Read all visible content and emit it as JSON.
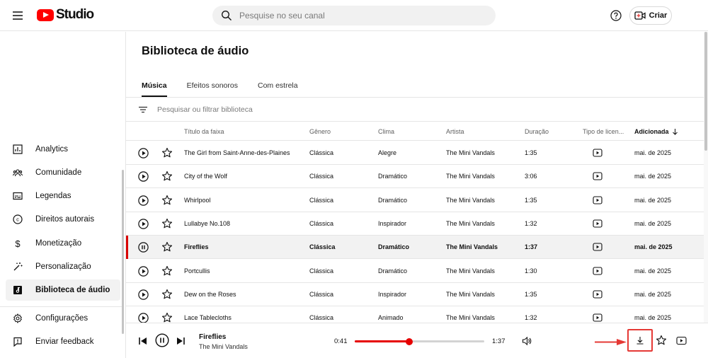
{
  "app": {
    "brand": "Studio",
    "accent": "#ff0000"
  },
  "header": {
    "search_placeholder": "Pesquise no seu canal",
    "create_label": "Criar"
  },
  "sidebar": {
    "items": [
      {
        "label": "Analytics",
        "icon": "analytics-icon"
      },
      {
        "label": "Comunidade",
        "icon": "community-icon"
      },
      {
        "label": "Legendas",
        "icon": "subtitles-icon"
      },
      {
        "label": "Direitos autorais",
        "icon": "copyright-icon"
      },
      {
        "label": "Monetização",
        "icon": "dollar-icon"
      },
      {
        "label": "Personalização",
        "icon": "magic-wand-icon"
      },
      {
        "label": "Biblioteca de áudio",
        "icon": "audio-library-icon",
        "active": true
      }
    ],
    "bottom_items": [
      {
        "label": "Configurações",
        "icon": "gear-icon"
      },
      {
        "label": "Enviar feedback",
        "icon": "feedback-icon"
      }
    ]
  },
  "main": {
    "title": "Biblioteca de áudio",
    "tabs": [
      {
        "label": "Música",
        "active": true
      },
      {
        "label": "Efeitos sonoros"
      },
      {
        "label": "Com estrela"
      }
    ],
    "filter_placeholder": "Pesquisar ou filtrar biblioteca",
    "columns": {
      "title": "Título da faixa",
      "genre": "Gênero",
      "mood": "Clima",
      "artist": "Artista",
      "duration": "Duração",
      "license": "Tipo de licen...",
      "added": "Adicionada"
    },
    "rows": [
      {
        "title": "The Girl from Saint-Anne-des-Plaines",
        "genre": "Clássica",
        "mood": "Alegre",
        "artist": "The Mini Vandals",
        "duration": "1:35",
        "added": "mai. de 2025"
      },
      {
        "title": "City of the Wolf",
        "genre": "Clássica",
        "mood": "Dramático",
        "artist": "The Mini Vandals",
        "duration": "3:06",
        "added": "mai. de 2025"
      },
      {
        "title": "Whirlpool",
        "genre": "Clássica",
        "mood": "Dramático",
        "artist": "The Mini Vandals",
        "duration": "1:35",
        "added": "mai. de 2025"
      },
      {
        "title": "Lullabye No.108",
        "genre": "Clássica",
        "mood": "Inspirador",
        "artist": "The Mini Vandals",
        "duration": "1:32",
        "added": "mai. de 2025"
      },
      {
        "title": "Fireflies",
        "genre": "Clássica",
        "mood": "Dramático",
        "artist": "The Mini Vandals",
        "duration": "1:37",
        "added": "mai. de 2025",
        "playing": true
      },
      {
        "title": "Portcullis",
        "genre": "Clássica",
        "mood": "Dramático",
        "artist": "The Mini Vandals",
        "duration": "1:30",
        "added": "mai. de 2025"
      },
      {
        "title": "Dew on the Roses",
        "genre": "Clássica",
        "mood": "Inspirador",
        "artist": "The Mini Vandals",
        "duration": "1:35",
        "added": "mai. de 2025"
      },
      {
        "title": "Lace Tablecloths",
        "genre": "Clássica",
        "mood": "Animado",
        "artist": "The Mini Vandals",
        "duration": "1:32",
        "added": "mai. de 2025"
      }
    ]
  },
  "player": {
    "title": "Fireflies",
    "artist": "The Mini Vandals",
    "current": "0:41",
    "duration": "1:37",
    "progress": 0.42,
    "highlight_color": "#e53935"
  }
}
